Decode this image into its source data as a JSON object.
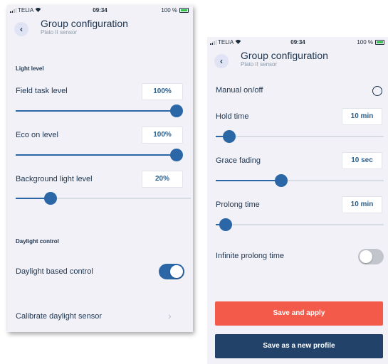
{
  "colors": {
    "accent": "#2b66a7",
    "background": "#f1f1f7",
    "primary_button": "#f45a4a",
    "secondary_button": "#22426a",
    "text": "#1e3550",
    "value_text": "#2b5f8e"
  },
  "statusbar": {
    "carrier": "TELIA",
    "time": "09:34",
    "battery": "100 %"
  },
  "screen_left": {
    "header": {
      "title": "Group configuration",
      "subtitle": "Plato II sensor",
      "back_icon": "chevron-left"
    },
    "light_level": {
      "heading": "Light level",
      "items": [
        {
          "label": "Field task level",
          "value": "100%",
          "level": 1.0
        },
        {
          "label": "Eco on level",
          "value": "100%",
          "level": 1.0
        },
        {
          "label": "Background light level",
          "value": "20%",
          "level": 0.2
        }
      ]
    },
    "daylight_control": {
      "heading": "Daylight control",
      "toggle_label": "Daylight based control",
      "toggle_on": true,
      "calibrate_label": "Calibrate daylight sensor",
      "calibrate_icon": "chevron-right"
    }
  },
  "screen_right": {
    "header": {
      "title": "Group configuration",
      "subtitle": "Plato II sensor",
      "back_icon": "chevron-left"
    },
    "manual_on_off": {
      "label": "Manual on/off",
      "selected": false
    },
    "items": [
      {
        "label": "Hold time",
        "value": "10 min",
        "level": 0.08
      },
      {
        "label": "Grace fading",
        "value": "10 sec",
        "level": 0.39
      },
      {
        "label": "Prolong time",
        "value": "10 min",
        "level": 0.06
      }
    ],
    "infinite_prolong": {
      "label": "Infinite prolong time",
      "on": false
    },
    "buttons": {
      "save_apply": "Save and apply",
      "save_profile": "Save as a new profile"
    }
  }
}
